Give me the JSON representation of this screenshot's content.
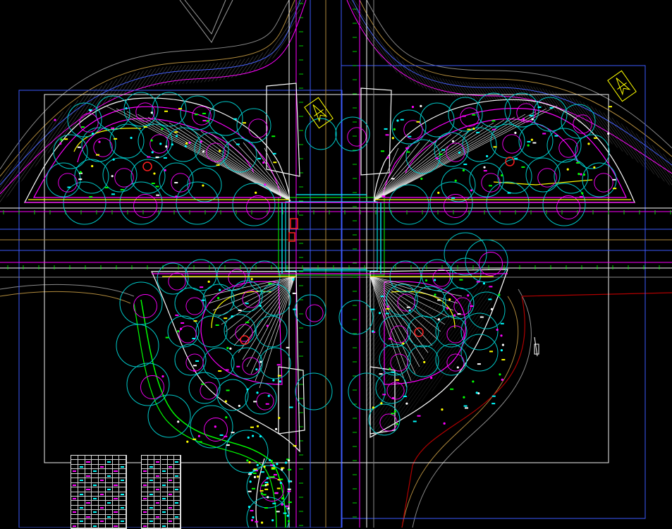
{
  "colors": {
    "background": "#000000",
    "road_outline": "#ffffff",
    "magenta_pipe": "#ff00ff",
    "sprinkler_circle": "#00c8c8",
    "cyan": "#00ffff",
    "yellow": "#ffff00",
    "green": "#00ff00",
    "blue_frame": "#3d5afe",
    "red": "#ff2020",
    "contour_brown": "#b08a3c",
    "contour_gray": "#8a8a8a",
    "red_boundary": "#b00000"
  },
  "icons": [
    "north-arrow-icon",
    "north-arrow-icon"
  ],
  "tables": [
    {
      "name": "legend-table-1",
      "rows": 16,
      "cols": 8
    },
    {
      "name": "legend-table-2",
      "rows": 16,
      "cols": 6
    }
  ]
}
